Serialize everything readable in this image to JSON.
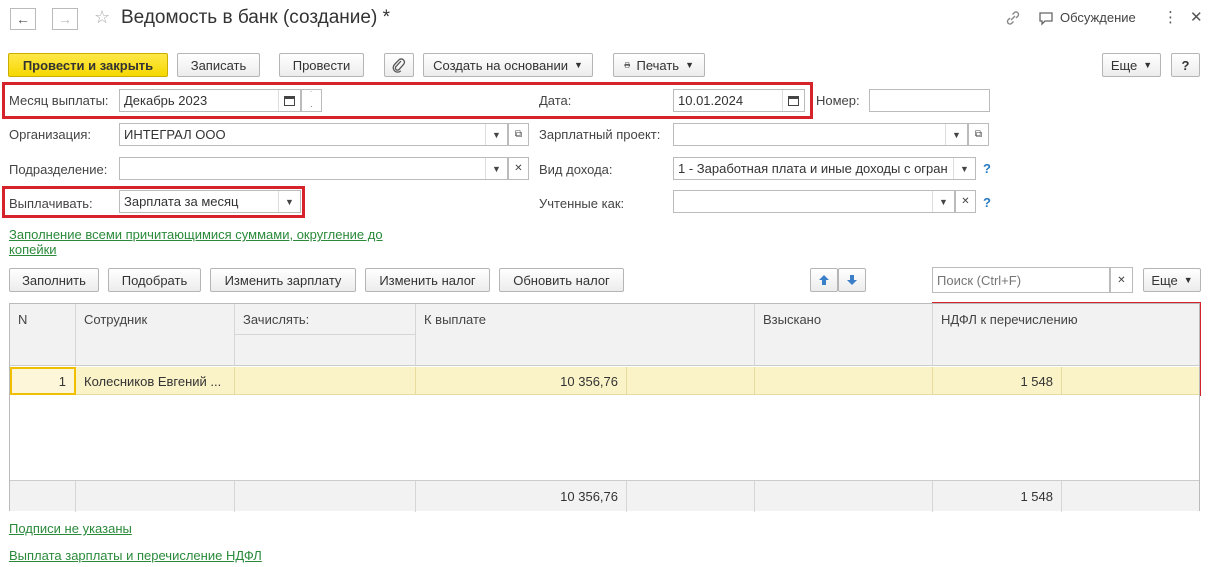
{
  "window": {
    "title": "Ведомость в банк (создание) *",
    "discussion_label": "Обсуждение"
  },
  "toolbar": {
    "post_and_close": "Провести и закрыть",
    "save": "Записать",
    "post": "Провести",
    "create_based_on": "Создать на основании",
    "print": "Печать",
    "more": "Еще",
    "help": "?"
  },
  "form": {
    "pay_month_label": "Месяц выплаты:",
    "pay_month_value": "Декабрь 2023",
    "date_label": "Дата:",
    "date_value": "10.01.2024",
    "number_label": "Номер:",
    "number_value": "",
    "organization_label": "Организация:",
    "organization_value": "ИНТЕГРАЛ ООО",
    "salary_project_label": "Зарплатный проект:",
    "salary_project_value": "",
    "department_label": "Подразделение:",
    "department_value": "",
    "income_type_label": "Вид дохода:",
    "income_type_value": "1 - Заработная плата и иные доходы с огран",
    "pay_label": "Выплачивать:",
    "pay_value": "Зарплата за месяц",
    "accounted_as_label": "Учтенные как:",
    "accounted_as_value": "",
    "fill_link_line1": "Заполнение всеми причитающимися суммами, округление до",
    "fill_link_line2": "копейки"
  },
  "table_toolbar": {
    "fill": "Заполнить",
    "select": "Подобрать",
    "change_salary": "Изменить зарплату",
    "change_tax": "Изменить налог",
    "update_tax": "Обновить налог",
    "search_placeholder": "Поиск (Ctrl+F)",
    "more": "Еще"
  },
  "table": {
    "columns": {
      "n": "N",
      "employee": "Сотрудник",
      "credit": "Зачислять:",
      "to_pay": "К выплате",
      "withheld": "Взыскано",
      "ndfl": "НДФЛ к перечислению"
    },
    "rows": [
      {
        "n": "1",
        "employee": "Колесников Евгений ...",
        "credit": "",
        "to_pay": "10 356,76",
        "withheld": "",
        "ndfl": "1 548"
      }
    ],
    "totals": {
      "to_pay": "10 356,76",
      "ndfl": "1 548"
    }
  },
  "footer": {
    "signatures_link": "Подписи не указаны",
    "payment_link": "Выплата зарплаты и перечисление НДФЛ"
  },
  "colors": {
    "primary_button": "#f5d800",
    "highlight_border": "#d6232b",
    "link": "#2a8a3a",
    "selected_row": "#fbf3c8"
  }
}
